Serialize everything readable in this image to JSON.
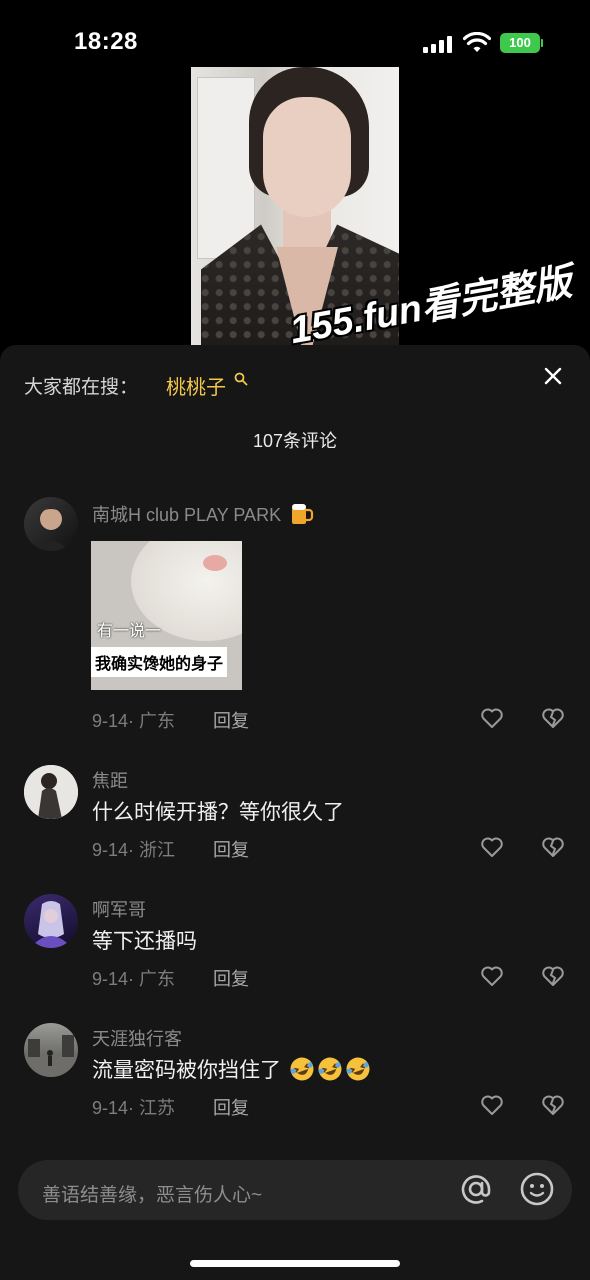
{
  "status_bar": {
    "time": "18:28",
    "battery": "100"
  },
  "panel": {
    "search_hint": "大家都在搜：",
    "search_keyword": "桃桃子",
    "watermark": "155.fun看完整版",
    "comment_count": "107条评论"
  },
  "comments": [
    {
      "username": "南城H club PLAY PARK",
      "username_emoji": "beer-mug-icon",
      "sticker": {
        "line1": "有一说一",
        "line2": "我确实馋她的身子"
      },
      "date": "9-14",
      "location": "广东",
      "reply": "回复"
    },
    {
      "username": "焦距",
      "text": "什么时候开播？等你很久了",
      "date": "9-14",
      "location": "浙江",
      "reply": "回复"
    },
    {
      "username": "啊军哥",
      "text": "等下还播吗",
      "date": "9-14",
      "location": "广东",
      "reply": "回复"
    },
    {
      "username": "天涯独行客",
      "text": "流量密码被你挡住了",
      "text_emojis": [
        "laughing-crying-emoji",
        "laughing-crying-emoji",
        "laughing-crying-emoji"
      ],
      "date": "9-14",
      "location": "江苏",
      "reply": "回复"
    }
  ],
  "input": {
    "placeholder": "善语结善缘，恶言伤人心~"
  },
  "colors": {
    "keyword": "#f2c74a",
    "panel_bg": "#161616",
    "battery": "#3ec94e"
  }
}
